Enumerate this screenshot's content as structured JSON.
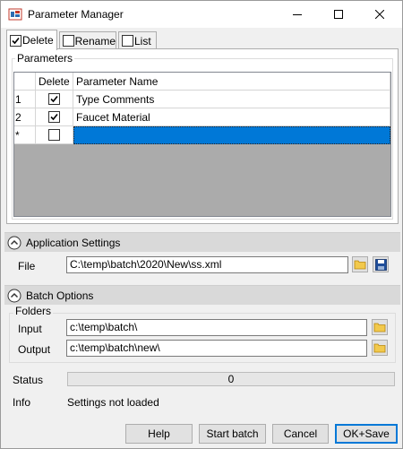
{
  "window": {
    "title": "Parameter Manager"
  },
  "tabs": [
    {
      "label": "Delete",
      "checked": true
    },
    {
      "label": "Rename",
      "checked": false
    },
    {
      "label": "List",
      "checked": false
    }
  ],
  "parameters": {
    "group_label": "Parameters",
    "columns": [
      "Delete",
      "Parameter Name"
    ],
    "rows": [
      {
        "index": "1",
        "delete": true,
        "name": "Type Comments"
      },
      {
        "index": "2",
        "delete": true,
        "name": "Faucet Material"
      },
      {
        "index": "*",
        "delete": false,
        "name": ""
      }
    ]
  },
  "application_settings": {
    "header": "Application Settings",
    "file_label": "File",
    "file_value": "C:\\temp\\batch\\2020\\New\\ss.xml"
  },
  "batch_options": {
    "header": "Batch Options",
    "folders_label": "Folders",
    "input_label": "Input",
    "input_value": "c:\\temp\\batch\\",
    "output_label": "Output",
    "output_value": "c:\\temp\\batch\\new\\"
  },
  "status": {
    "label": "Status",
    "progress_text": "0",
    "progress_fraction": 0
  },
  "info": {
    "label": "Info",
    "value": "Settings not loaded"
  },
  "buttons": {
    "help": "Help",
    "start": "Start batch",
    "cancel": "Cancel",
    "ok": "OK+Save"
  },
  "colors": {
    "selection": "#0078d7",
    "section_bar": "#d9d9d9",
    "window_bg": "#f0f0f0"
  }
}
